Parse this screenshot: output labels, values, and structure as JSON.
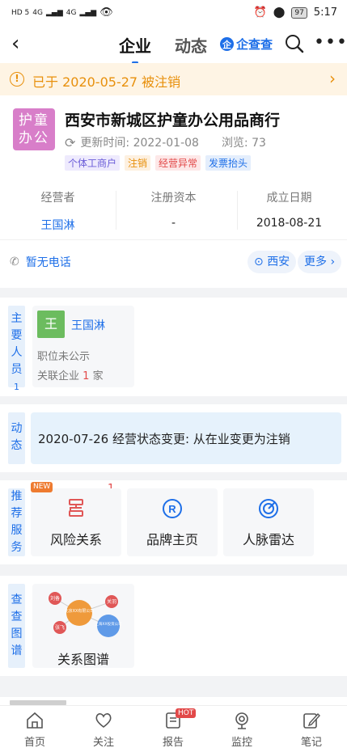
{
  "status_bar": {
    "left_1": "HD 5",
    "left_2": "4G",
    "left_3": "4G",
    "battery": "97",
    "time": "5:17"
  },
  "nav": {
    "tab_company": "企业",
    "tab_dynamics": "动态",
    "brand": "企查查"
  },
  "alert": {
    "text": "已于 2020-05-27 被注销"
  },
  "company": {
    "logo_line1": "护童",
    "logo_line2": "办公",
    "name": "西安市新城区护童办公用品商行",
    "updated_label": "更新时间: 2022-01-08",
    "views_label": "浏览: 73",
    "tags": [
      "个体工商户",
      "注销",
      "经营异常",
      "发票抬头"
    ],
    "stats": [
      {
        "label": "经营者",
        "value": "王国淋"
      },
      {
        "label": "注册资本",
        "value": "-"
      },
      {
        "label": "成立日期",
        "value": "2018-08-21"
      }
    ],
    "phone": "暂无电话",
    "location": "西安",
    "more": "更多"
  },
  "key_people": {
    "label": [
      "主",
      "要",
      "人",
      "员",
      "1"
    ],
    "avatar_char": "王",
    "name": "王国淋",
    "role": "职位未公示",
    "related_prefix": "关联企业",
    "related_count": "1",
    "related_suffix": "家"
  },
  "dynamics": {
    "label": [
      "动",
      "态"
    ],
    "text": "2020-07-26 经营状态变更: 从在业变更为注销"
  },
  "services": {
    "label": [
      "推",
      "荐",
      "服",
      "务"
    ],
    "new_badge": "NEW",
    "risk_count": "1",
    "items": [
      "风险关系",
      "品牌主页",
      "人脉雷达"
    ]
  },
  "graph": {
    "label": [
      "查",
      "查",
      "图",
      "谱"
    ],
    "nodes": [
      "刘备",
      "北京XX有限公司",
      "关羽",
      "张飞",
      "上海XX投资公司"
    ],
    "title": "关系图谱"
  },
  "bottom_nav": {
    "items": [
      "首页",
      "关注",
      "报告",
      "监控",
      "笔记"
    ],
    "hot_badge": "HOT"
  }
}
